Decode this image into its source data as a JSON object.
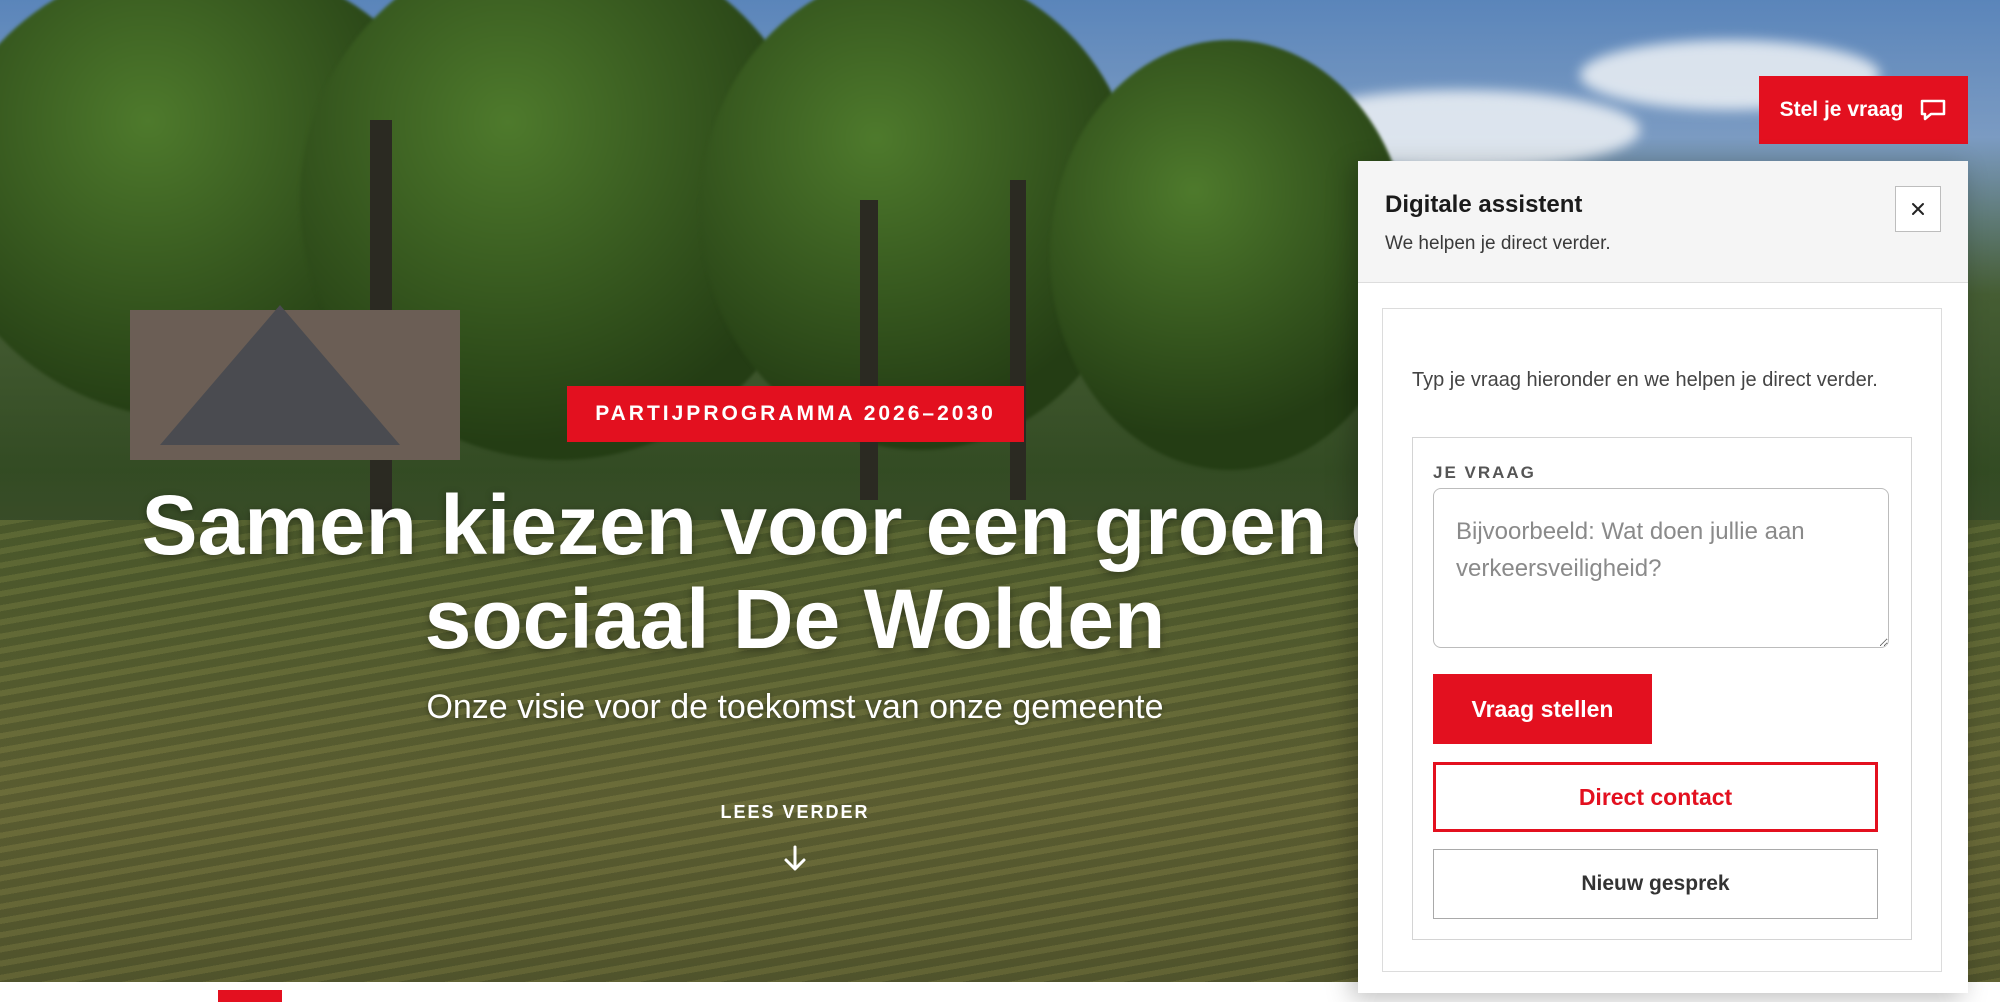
{
  "hero": {
    "badge": "PARTIJPROGRAMMA 2026–2030",
    "title": "Samen kiezen voor een groen en sociaal De Wolden",
    "subtitle": "Onze visie voor de toekomst van onze gemeente",
    "read_more": "LEES VERDER",
    "read_more_icon": "arrow-down-icon"
  },
  "ask_button": {
    "label": "Stel je vraag",
    "icon": "chat-bubble-icon"
  },
  "assistant": {
    "title": "Digitale assistent",
    "subtitle": "We helpen je direct verder.",
    "close_icon": "close-icon",
    "intro": "Typ je vraag hieronder en we helpen je direct verder.",
    "field_label": "JE VRAAG",
    "input_value": "",
    "input_placeholder": "Bijvoorbeeld: Wat doen jullie aan verkeersveiligheid?",
    "submit_label": "Vraag stellen",
    "contact_label": "Direct contact",
    "new_chat_label": "Nieuw gesprek"
  },
  "colors": {
    "brand_red": "#e3101f",
    "panel_header_bg": "#f5f5f5"
  }
}
